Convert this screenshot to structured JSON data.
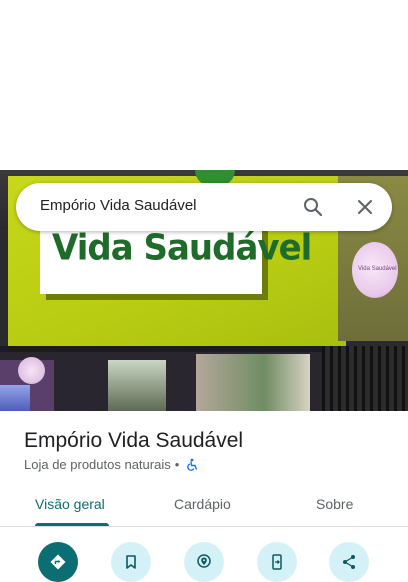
{
  "search": {
    "query": "Empório Vida Saudável"
  },
  "photo": {
    "sign_text": "Vida Saudável",
    "round_sign_text": "Vida Saudável"
  },
  "place": {
    "name": "Empório Vida Saudável",
    "category": "Loja de produtos naturais",
    "separator": "•",
    "accessibility_icon": "wheelchair-icon"
  },
  "tabs": [
    {
      "label": "Visão geral",
      "selected": true
    },
    {
      "label": "Cardápio",
      "selected": false
    },
    {
      "label": "Sobre",
      "selected": false
    }
  ],
  "actions": [
    {
      "icon": "directions-icon",
      "primary": true
    },
    {
      "icon": "bookmark-icon",
      "primary": false
    },
    {
      "icon": "nearby-icon",
      "primary": false
    },
    {
      "icon": "send-to-phone-icon",
      "primary": false
    },
    {
      "icon": "share-icon",
      "primary": false
    }
  ],
  "colors": {
    "accent": "#0b6e73",
    "action_bg": "#d4f1f7"
  }
}
